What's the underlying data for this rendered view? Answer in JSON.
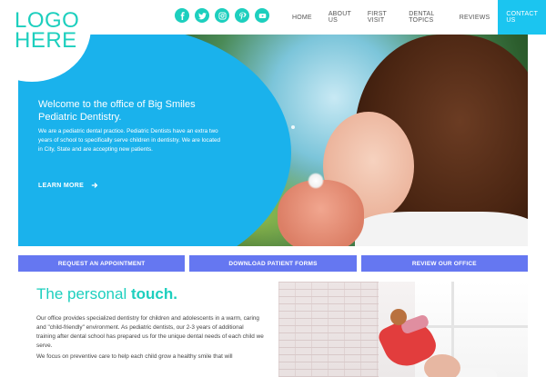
{
  "header": {
    "logo_line1": "LOGO",
    "logo_line2": "HERE",
    "social_icons": [
      "facebook-icon",
      "twitter-icon",
      "instagram-icon",
      "pinterest-icon",
      "youtube-icon"
    ],
    "nav": [
      {
        "label": "HOME"
      },
      {
        "label": "ABOUT US"
      },
      {
        "label": "FIRST VISIT"
      },
      {
        "label": "DENTAL TOPICS"
      },
      {
        "label": "REVIEWS"
      },
      {
        "label": "CONTACT US",
        "active": true
      }
    ]
  },
  "hero": {
    "title": "Welcome to the office of Big Smiles Pediatric Dentistry.",
    "body": "We are a pediatric dental practice. Pediatric Dentists have an extra two years of school to specifically serve children in dentistry. We are located in City, State and are accepting new patients.",
    "cta": "LEARN MORE"
  },
  "actions": [
    {
      "label": "REQUEST AN APPOINTMENT"
    },
    {
      "label": "DOWNLOAD PATIENT FORMS"
    },
    {
      "label": "REVIEW OUR OFFICE"
    }
  ],
  "touch": {
    "title_prefix": "The personal ",
    "title_bold": "touch.",
    "paragraph1": "Our office provides specialized dentistry for children and adolescents in a warm, caring and \"child-friendly\" environment. As pediatric dentists, our 2-3 years of additional training after dental school has prepared us for the unique dental needs of each child we serve.",
    "paragraph2": "We focus on preventive care to help each child grow a healthy smile that will"
  },
  "colors": {
    "teal": "#1dcfbe",
    "hero_blue": "#1ab2ec",
    "nav_active": "#1bc5f0",
    "button_purple": "#6577f1"
  }
}
